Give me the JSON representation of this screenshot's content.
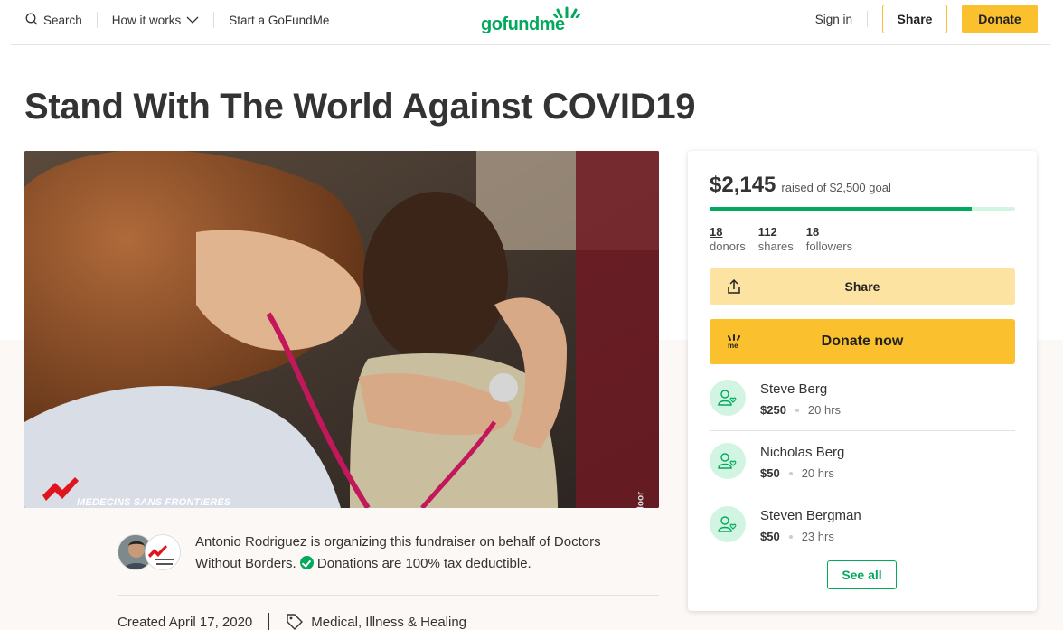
{
  "header": {
    "search_label": "Search",
    "how_it_works_label": "How it works",
    "start_label": "Start a GoFundMe",
    "logo_text": "gofundme",
    "signin_label": "Sign in",
    "share_label": "Share",
    "donate_label": "Donate"
  },
  "campaign": {
    "title": "Stand With The World Against COVID19",
    "photo_caption_logo": "MEDECINS SANS FRONTIERES",
    "photo_credit": "cesco Zizola/Noor",
    "organizer_text": "Antonio Rodriguez is organizing this fundraiser on behalf of Doctors Without Borders.",
    "tax_text": "Donations are 100% tax deductible.",
    "created": "Created April 17, 2020",
    "category": "Medical, Illness & Healing"
  },
  "sidebar": {
    "raised_amount": "$2,145",
    "goal_text": "raised of $2,500 goal",
    "progress_fraction": 0.858,
    "stats": [
      {
        "num": "18",
        "label": "donors"
      },
      {
        "num": "112",
        "label": "shares"
      },
      {
        "num": "18",
        "label": "followers"
      }
    ],
    "share_label": "Share",
    "donate_now_label": "Donate now",
    "donations": [
      {
        "name": "Steve Berg",
        "amount": "$250",
        "time": "20 hrs"
      },
      {
        "name": "Nicholas Berg",
        "amount": "$50",
        "time": "20 hrs"
      },
      {
        "name": "Steven Bergman",
        "amount": "$50",
        "time": "23 hrs"
      }
    ],
    "see_all_label": "See all"
  },
  "colors": {
    "brand_green": "#02a95c",
    "donate_yellow": "#fbc02d",
    "share_yellow": "#fce3a2"
  }
}
